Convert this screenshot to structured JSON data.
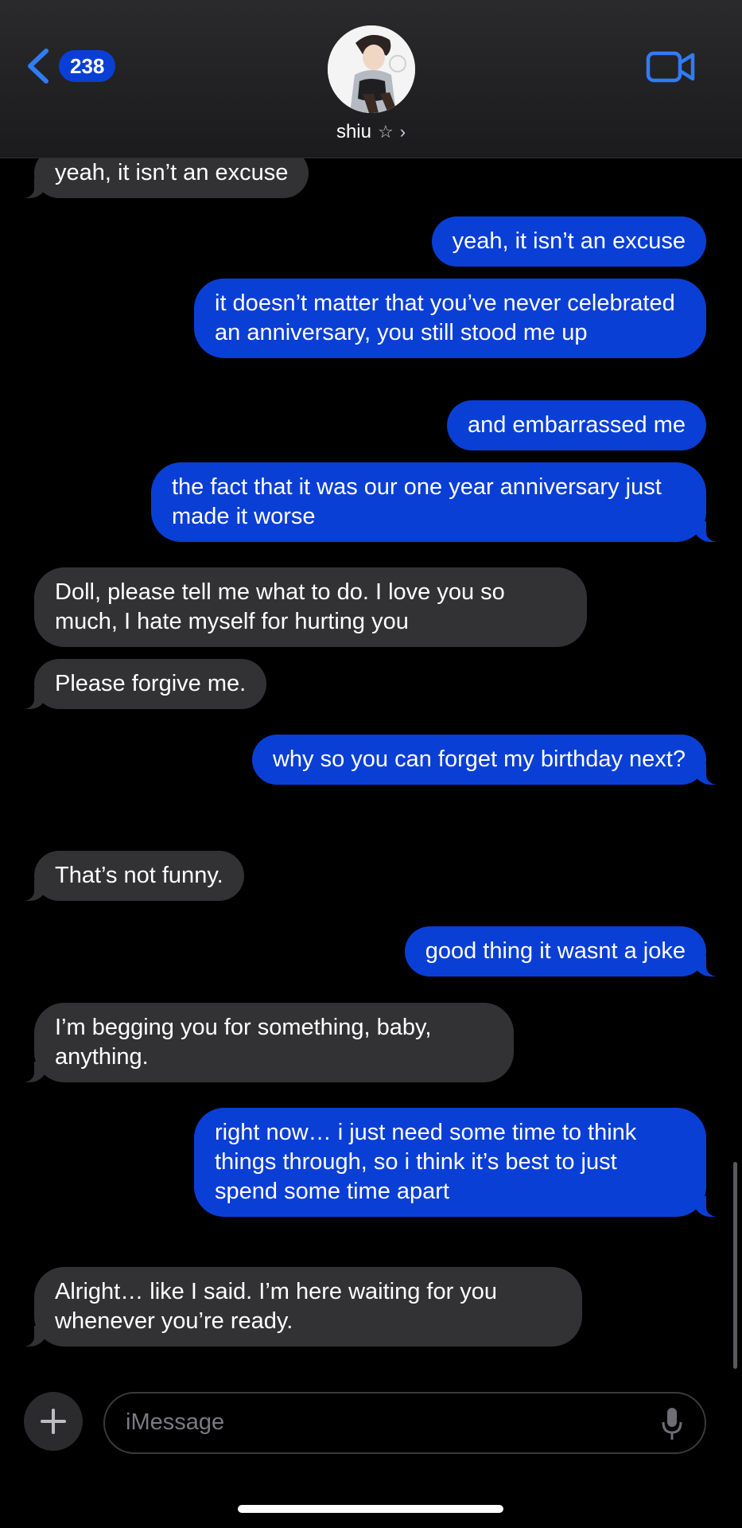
{
  "header": {
    "back_badge": "238",
    "contact_name": "shiu",
    "star_glyph": "☆",
    "chevron_glyph": "›",
    "avatar_icon": "avatar-illustration",
    "video_icon": "video-camera-icon"
  },
  "messages": [
    {
      "dir": "recv",
      "text": "yeah, it isn’t an excuse"
    },
    {
      "dir": "sent",
      "text": "yeah, it isn’t an excuse"
    },
    {
      "dir": "sent",
      "text": "it doesn’t matter that you’ve never celebrated an anniversary, you still stood me up"
    },
    {
      "dir": "sent",
      "text": "and embarrassed me"
    },
    {
      "dir": "sent",
      "text": "the fact that it was our one year anniversary just made it worse"
    },
    {
      "dir": "recv",
      "text": "Doll, please tell me what to do. I love you so much, I hate myself for hurting you"
    },
    {
      "dir": "recv",
      "text": "Please forgive me."
    },
    {
      "dir": "sent",
      "text": "why so you can forget my birthday next?"
    },
    {
      "dir": "recv",
      "text": "That’s not funny."
    },
    {
      "dir": "sent",
      "text": "good thing it wasnt a joke"
    },
    {
      "dir": "recv",
      "text": "I’m begging you for something, baby, anything."
    },
    {
      "dir": "sent",
      "text": "right now… i just need some time to think things through, so i think it’s best to just spend some time apart"
    },
    {
      "dir": "recv",
      "text": "Alright… like I said. I’m here waiting for you whenever you’re ready."
    }
  ],
  "composer": {
    "placeholder": "iMessage"
  },
  "colors": {
    "sent_bubble": "#0a3fd6",
    "received_bubble": "#323235",
    "accent": "#2f7cf6",
    "background": "#000000"
  }
}
